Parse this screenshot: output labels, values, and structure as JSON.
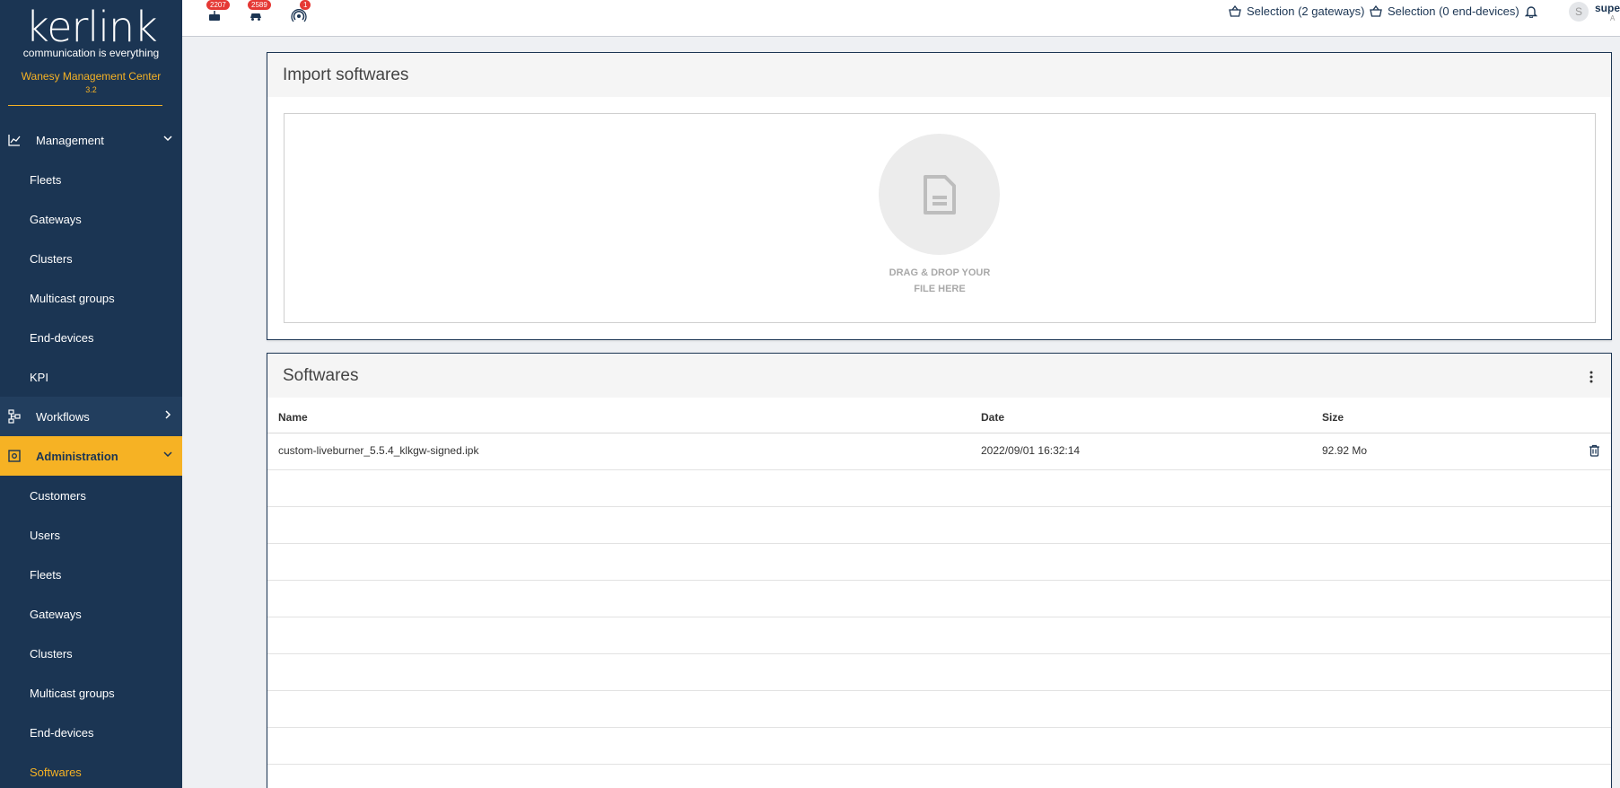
{
  "brand": {
    "logo": "kerlink",
    "tagline": "communication is everything",
    "app_name": "Wanesy Management Center",
    "version": "3.2"
  },
  "sidebar": {
    "management": {
      "label": "Management",
      "items": [
        "Fleets",
        "Gateways",
        "Clusters",
        "Multicast groups",
        "End-devices",
        "KPI"
      ]
    },
    "workflows": {
      "label": "Workflows"
    },
    "administration": {
      "label": "Administration",
      "items": [
        "Customers",
        "Users",
        "Fleets",
        "Gateways",
        "Clusters",
        "Multicast groups",
        "End-devices",
        "Softwares"
      ],
      "active": "Softwares"
    }
  },
  "topbar": {
    "badges": {
      "gateways": "2207",
      "end_devices": "2589",
      "alarms": "1"
    },
    "selection_gateways": "Selection (2 gateways)",
    "selection_end_devices": "Selection (0 end-devices)",
    "avatar_initial": "S",
    "user_name": "super",
    "user_sub": "A"
  },
  "import_panel": {
    "title": "Import softwares",
    "drop_line1": "DRAG & DROP YOUR",
    "drop_line2": "FILE HERE"
  },
  "softwares_panel": {
    "title": "Softwares",
    "columns": {
      "name": "Name",
      "date": "Date",
      "size": "Size"
    },
    "rows": [
      {
        "name": "custom-liveburner_5.5.4_klkgw-signed.ipk",
        "date": "2022/09/01 16:32:14",
        "size": "92.92 Mo"
      }
    ]
  },
  "colors": {
    "navy": "#1b3553",
    "accent": "#f6b224"
  }
}
